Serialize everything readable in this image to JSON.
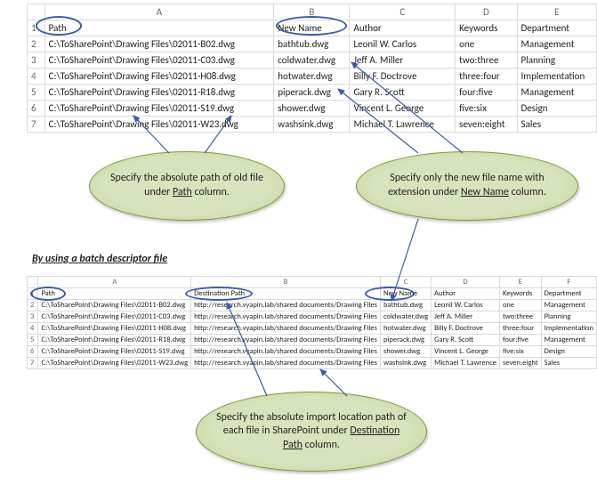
{
  "sheet1": {
    "col_letters": [
      "A",
      "B",
      "C",
      "D",
      "E"
    ],
    "headers": {
      "path": "Path",
      "new_name": "New Name",
      "author": "Author",
      "keywords": "Keywords",
      "department": "Department"
    },
    "rows": [
      {
        "path": "C:\\ToSharePoint\\Drawing Files\\02011-B02.dwg",
        "new_name": "bathtub.dwg",
        "author": "Leonil W. Carlos",
        "keywords": "one",
        "department": "Management"
      },
      {
        "path": "C:\\ToSharePoint\\Drawing Files\\02011-C03.dwg",
        "new_name": "coldwater.dwg",
        "author": "Jeff A. Miller",
        "keywords": "two:three",
        "department": "Planning"
      },
      {
        "path": "C:\\ToSharePoint\\Drawing Files\\02011-H08.dwg",
        "new_name": "hotwater.dwg",
        "author": "Billy F. Doctrove",
        "keywords": "three:four",
        "department": "Implementation"
      },
      {
        "path": "C:\\ToSharePoint\\Drawing Files\\02011-R18.dwg",
        "new_name": "piperack.dwg",
        "author": "Gary R. Scott",
        "keywords": "four:five",
        "department": "Management"
      },
      {
        "path": "C:\\ToSharePoint\\Drawing Files\\02011-S19.dwg",
        "new_name": "shower.dwg",
        "author": "Vincent L. George",
        "keywords": "five:six",
        "department": "Design"
      },
      {
        "path": "C:\\ToSharePoint\\Drawing Files\\02011-W23.dwg",
        "new_name": "washsink.dwg",
        "author": "Michael T. Lawrence",
        "keywords": "seven:eight",
        "department": "Sales"
      }
    ]
  },
  "section_title": "By using a batch descriptor file",
  "sheet2": {
    "col_letters": [
      "A",
      "B",
      "C",
      "D",
      "E",
      "F"
    ],
    "headers": {
      "path": "Path",
      "dest": "Destination Path",
      "new_name": "New Name",
      "author": "Author",
      "keywords": "Keywords",
      "department": "Department"
    },
    "rows": [
      {
        "path": "C:\\ToSharePoint\\Drawing Files\\02011-B02.dwg",
        "dest": "http://research.vyapin.lab/shared documents/Drawing Files",
        "new_name": "bathtub.dwg",
        "author": "Leonil W. Carlos",
        "keywords": "one",
        "department": "Management"
      },
      {
        "path": "C:\\ToSharePoint\\Drawing Files\\02011-C03.dwg",
        "dest": "http://research.vyapin.lab/shared documents/Drawing Files",
        "new_name": "coldwater.dwg",
        "author": "Jeff A. Miller",
        "keywords": "two:three",
        "department": "Planning"
      },
      {
        "path": "C:\\ToSharePoint\\Drawing Files\\02011-H08.dwg",
        "dest": "http://research.vyapin.lab/shared documents/Drawing Files",
        "new_name": "hotwater.dwg",
        "author": "Billy F. Doctrove",
        "keywords": "three:four",
        "department": "Implementation"
      },
      {
        "path": "C:\\ToSharePoint\\Drawing Files\\02011-R18.dwg",
        "dest": "http://research.vyapin.lab/shared documents/Drawing Files",
        "new_name": "piperack.dwg",
        "author": "Gary R. Scott",
        "keywords": "four:five",
        "department": "Management"
      },
      {
        "path": "C:\\ToSharePoint\\Drawing Files\\02011-S19.dwg",
        "dest": "http://research.vyapin.lab/shared documents/Drawing Files",
        "new_name": "shower.dwg",
        "author": "Vincent L. George",
        "keywords": "five:six",
        "department": "Design"
      },
      {
        "path": "C:\\ToSharePoint\\Drawing Files\\02011-W23.dwg",
        "dest": "http://research.vyapin.lab/shared documents/Drawing Files",
        "new_name": "washsink.dwg",
        "author": "Michael T. Lawrence",
        "keywords": "seven:eight",
        "department": "Sales"
      }
    ]
  },
  "callouts": {
    "path": {
      "pre": "Specify the absolute path of old file under ",
      "u": "Path",
      "post": " column."
    },
    "newname": {
      "pre": "Specify only the new file name with extension under ",
      "u": "New Name",
      "post": " column."
    },
    "dest": {
      "pre": "Specify the absolute import location path of each file in SharePoint under ",
      "u": "Destination Path",
      "post": " column."
    }
  }
}
